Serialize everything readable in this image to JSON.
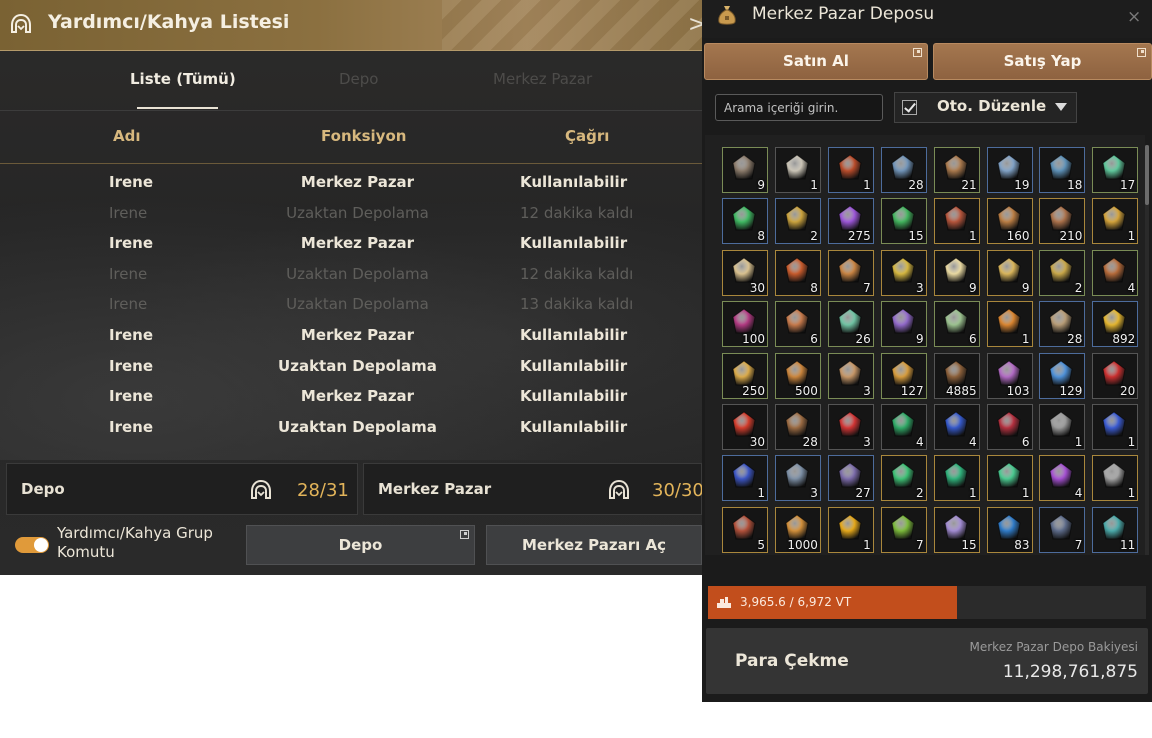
{
  "left_panel": {
    "title": "Yardımcı/Kahya Listesi",
    "close": ">",
    "tabs": [
      {
        "label": "Liste (Tümü)",
        "active": true
      },
      {
        "label": "Depo",
        "active": false
      },
      {
        "label": "Merkez Pazar",
        "active": false
      }
    ],
    "columns": [
      "Adı",
      "Fonksiyon",
      "Çağrı"
    ],
    "rows": [
      {
        "name": "Irene",
        "function": "Merkez Pazar",
        "call": "Kullanılabilir",
        "available": true
      },
      {
        "name": "Irene",
        "function": "Uzaktan Depolama",
        "call": "12 dakika kaldı",
        "available": false
      },
      {
        "name": "Irene",
        "function": "Merkez Pazar",
        "call": "Kullanılabilir",
        "available": true
      },
      {
        "name": "Irene",
        "function": "Uzaktan Depolama",
        "call": "12 dakika kaldı",
        "available": false
      },
      {
        "name": "Irene",
        "function": "Uzaktan Depolama",
        "call": "13 dakika kaldı",
        "available": false
      },
      {
        "name": "Irene",
        "function": "Merkez Pazar",
        "call": "Kullanılabilir",
        "available": true
      },
      {
        "name": "Irene",
        "function": "Uzaktan Depolama",
        "call": "Kullanılabilir",
        "available": true
      },
      {
        "name": "Irene",
        "function": "Merkez Pazar",
        "call": "Kullanılabilir",
        "available": true
      },
      {
        "name": "Irene",
        "function": "Uzaktan Depolama",
        "call": "Kullanılabilir",
        "available": true
      }
    ],
    "summary": {
      "depo_label": "Depo",
      "depo_value": "28/31",
      "mp_label": "Merkez Pazar",
      "mp_value": "30/30"
    },
    "group_command_label": "Yardımcı/Kahya Grup Komutu",
    "group_command_on": true,
    "btn_depo": "Depo",
    "btn_mp_open": "Merkez Pazarı Aç"
  },
  "right_panel": {
    "title": "Merkez Pazar Deposu",
    "close": "×",
    "btn_buy": "Satın Al",
    "btn_sell": "Satış Yap",
    "search_placeholder": "Arama içeriği girin.",
    "auto_sort_label": "Oto. Düzenle",
    "auto_sort_checked": true,
    "items": [
      {
        "icon": "hide-icon",
        "count": "9",
        "color": "#8a7a6a",
        "border": "g"
      },
      {
        "icon": "wool-icon",
        "count": "1",
        "color": "#c9c3b5",
        "border": ""
      },
      {
        "icon": "necklace-icon",
        "count": "1",
        "color": "#b74b2a",
        "border": "b"
      },
      {
        "icon": "sword-icon",
        "count": "28",
        "color": "#6f92b6",
        "border": "b"
      },
      {
        "icon": "spear-icon",
        "count": "21",
        "color": "#a8784c",
        "border": "g"
      },
      {
        "icon": "pickaxe-icon",
        "count": "19",
        "color": "#7fa0c4",
        "border": "b"
      },
      {
        "icon": "blade-icon",
        "count": "18",
        "color": "#5c8fb5",
        "border": "b"
      },
      {
        "icon": "staff-icon",
        "count": "17",
        "color": "#5ec59a",
        "border": "g"
      },
      {
        "icon": "green-stone-icon",
        "count": "8",
        "color": "#3fb862",
        "border": "b"
      },
      {
        "icon": "gold-stone-icon",
        "count": "2",
        "color": "#caa23d",
        "border": "b"
      },
      {
        "icon": "purple-stone-icon",
        "count": "275",
        "color": "#9a55d6",
        "border": "b"
      },
      {
        "icon": "green-stone-icon",
        "count": "15",
        "color": "#42b35d",
        "border": "g"
      },
      {
        "icon": "meal-icon",
        "count": "1",
        "color": "#b4543b",
        "border": "y"
      },
      {
        "icon": "meal-icon",
        "count": "160",
        "color": "#b87c43",
        "border": "y"
      },
      {
        "icon": "meal-icon",
        "count": "210",
        "color": "#a9704a",
        "border": "y"
      },
      {
        "icon": "meal-box-icon",
        "count": "1",
        "color": "#d2a23a",
        "border": "y"
      },
      {
        "icon": "soup-icon",
        "count": "30",
        "color": "#d8c08e",
        "border": "y"
      },
      {
        "icon": "stew-icon",
        "count": "8",
        "color": "#c65a2c",
        "border": "y"
      },
      {
        "icon": "stew-icon",
        "count": "7",
        "color": "#c78342",
        "border": "y"
      },
      {
        "icon": "elixir-icon",
        "count": "3",
        "color": "#d4b640",
        "border": "y"
      },
      {
        "icon": "tea-icon",
        "count": "9",
        "color": "#e8d8a0",
        "border": "y"
      },
      {
        "icon": "flask-icon",
        "count": "9",
        "color": "#d8b45a",
        "border": "y"
      },
      {
        "icon": "bottle-icon",
        "count": "2",
        "color": "#c7a648",
        "border": "g"
      },
      {
        "icon": "bottle-icon",
        "count": "4",
        "color": "#b46a3a",
        "border": "g"
      },
      {
        "icon": "potion-icon",
        "count": "100",
        "color": "#b13a82",
        "border": "g"
      },
      {
        "icon": "potion-icon",
        "count": "6",
        "color": "#c4784a",
        "border": "g"
      },
      {
        "icon": "potion-icon",
        "count": "26",
        "color": "#6fc2a2",
        "border": "g"
      },
      {
        "icon": "vial-icon",
        "count": "9",
        "color": "#9068c8",
        "border": "g"
      },
      {
        "icon": "herb-icon",
        "count": "6",
        "color": "#9ac08e",
        "border": "g"
      },
      {
        "icon": "bottle-icon",
        "count": "1",
        "color": "#d88430",
        "border": "y"
      },
      {
        "icon": "mushroom-icon",
        "count": "28",
        "color": "#b59a75",
        "border": "b"
      },
      {
        "icon": "sunflower-icon",
        "count": "892",
        "color": "#e3b530",
        "border": "b"
      },
      {
        "icon": "gold-ingot-icon",
        "count": "250",
        "color": "#d9a949",
        "border": "g"
      },
      {
        "icon": "onion-icon",
        "count": "500",
        "color": "#c9843c",
        "border": "g"
      },
      {
        "icon": "jar-icon",
        "count": "3",
        "color": "#c49566",
        "border": "g"
      },
      {
        "icon": "bowl-icon",
        "count": "127",
        "color": "#d49a3c",
        "border": "g"
      },
      {
        "icon": "figure-icon",
        "count": "4885",
        "color": "#8a5f3a",
        "border": ""
      },
      {
        "icon": "flower-icon",
        "count": "103",
        "color": "#b069c2",
        "border": ""
      },
      {
        "icon": "potion-icon",
        "count": "129",
        "color": "#4d8fd6",
        "border": "b"
      },
      {
        "icon": "red-potion-icon",
        "count": "20",
        "color": "#c93030",
        "border": ""
      },
      {
        "icon": "red-potion-icon",
        "count": "30",
        "color": "#d13c2c",
        "border": ""
      },
      {
        "icon": "rope-icon",
        "count": "28",
        "color": "#9a6a42",
        "border": ""
      },
      {
        "icon": "red-crystal-icon",
        "count": "3",
        "color": "#d03434",
        "border": ""
      },
      {
        "icon": "green-crystal-icon",
        "count": "4",
        "color": "#2fa866",
        "border": ""
      },
      {
        "icon": "blue-crystal-icon",
        "count": "4",
        "color": "#3558c8",
        "border": ""
      },
      {
        "icon": "red-crystal-icon",
        "count": "6",
        "color": "#b3303f",
        "border": ""
      },
      {
        "icon": "grey-crystal-icon",
        "count": "1",
        "color": "#9a9a9a",
        "border": ""
      },
      {
        "icon": "blue-cube-icon",
        "count": "1",
        "color": "#3a5ad0",
        "border": ""
      },
      {
        "icon": "blue-cube-icon",
        "count": "1",
        "color": "#3c55c2",
        "border": "b"
      },
      {
        "icon": "stone-icon",
        "count": "3",
        "color": "#7b8da3",
        "border": "b"
      },
      {
        "icon": "orb-icon",
        "count": "27",
        "color": "#7a6aa8",
        "border": "b"
      },
      {
        "icon": "gem-orb-icon",
        "count": "2",
        "color": "#3dbf74",
        "border": "y"
      },
      {
        "icon": "emerald-icon",
        "count": "1",
        "color": "#2fb07a",
        "border": "y"
      },
      {
        "icon": "emerald-icon",
        "count": "1",
        "color": "#49c78e",
        "border": "y"
      },
      {
        "icon": "amethyst-icon",
        "count": "4",
        "color": "#a34fd0",
        "border": "y"
      },
      {
        "icon": "grey-crystal-icon",
        "count": "1",
        "color": "#a4a4a4",
        "border": "y"
      },
      {
        "icon": "brick-icon",
        "count": "5",
        "color": "#b1503a",
        "border": "y"
      },
      {
        "icon": "ore-icon",
        "count": "1000",
        "color": "#d08e3a",
        "border": "y"
      },
      {
        "icon": "sun-orb-icon",
        "count": "1",
        "color": "#e3a61a",
        "border": "y"
      },
      {
        "icon": "green-flask-icon",
        "count": "7",
        "color": "#7ab83a",
        "border": "y"
      },
      {
        "icon": "pearl-icon",
        "count": "15",
        "color": "#a08ad0",
        "border": "y"
      },
      {
        "icon": "sapphire-icon",
        "count": "83",
        "color": "#2f7ac6",
        "border": "y"
      },
      {
        "icon": "cube-icon",
        "count": "7",
        "color": "#5c6a88",
        "border": "b"
      },
      {
        "icon": "teal-crystal-icon",
        "count": "11",
        "color": "#4aa8a8",
        "border": "b"
      }
    ],
    "weight_text": "3,965.6 / 6,972 VT",
    "weight_fraction": 0.569,
    "withdraw_label": "Para Çekme",
    "balance_label": "Merkez Pazar Depo Bakiyesi",
    "balance_value": "11,298,761,875"
  },
  "colors": {
    "title_gold": "#8b7040",
    "header_gold": "#d7b87e",
    "value_gold": "#e2b45a",
    "buy_brown": "#9a6d47",
    "weight_orange": "#c24e1c"
  }
}
